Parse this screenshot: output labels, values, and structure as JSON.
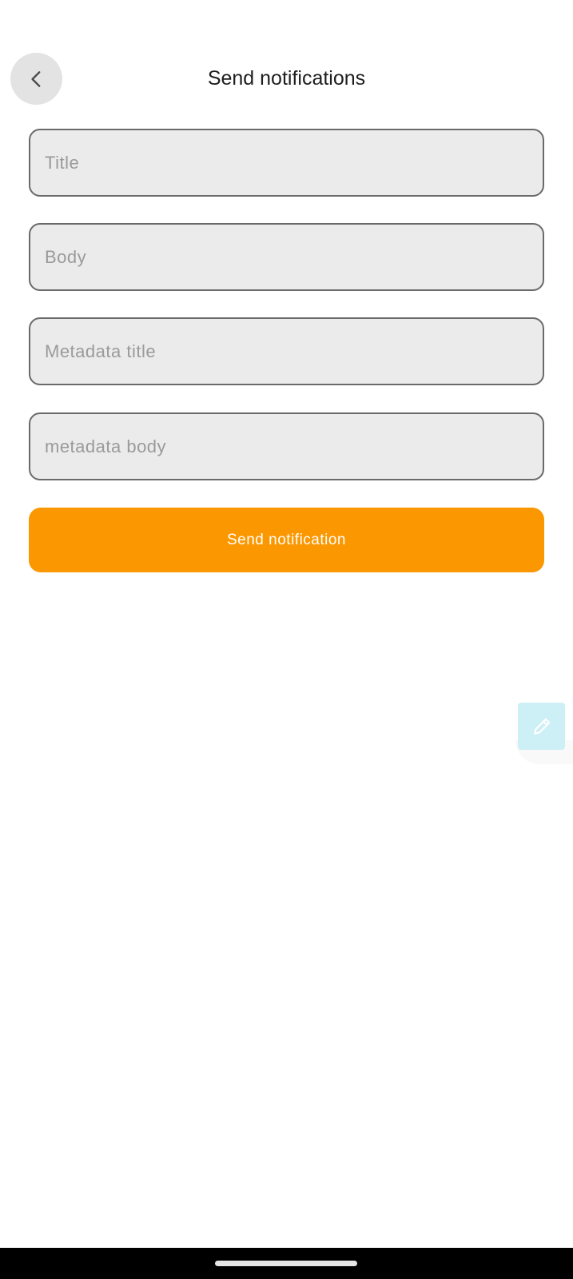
{
  "header": {
    "title": "Send notifications",
    "back_icon": "chevron-left-icon"
  },
  "form": {
    "title_placeholder": "Title",
    "title_value": "",
    "body_placeholder": "Body",
    "body_value": "",
    "metadata_title_placeholder": "Metadata title",
    "metadata_title_value": "",
    "metadata_body_placeholder": "metadata body",
    "metadata_body_value": "",
    "submit_label": "Send notification"
  },
  "floating_action": {
    "icon": "pencil-icon"
  },
  "colors": {
    "accent": "#fb9700",
    "field_background": "#ebebeb",
    "field_border": "#6a6a6a",
    "back_button_background": "#e3e3e3",
    "floating_tab_background": "#cdeff6"
  }
}
